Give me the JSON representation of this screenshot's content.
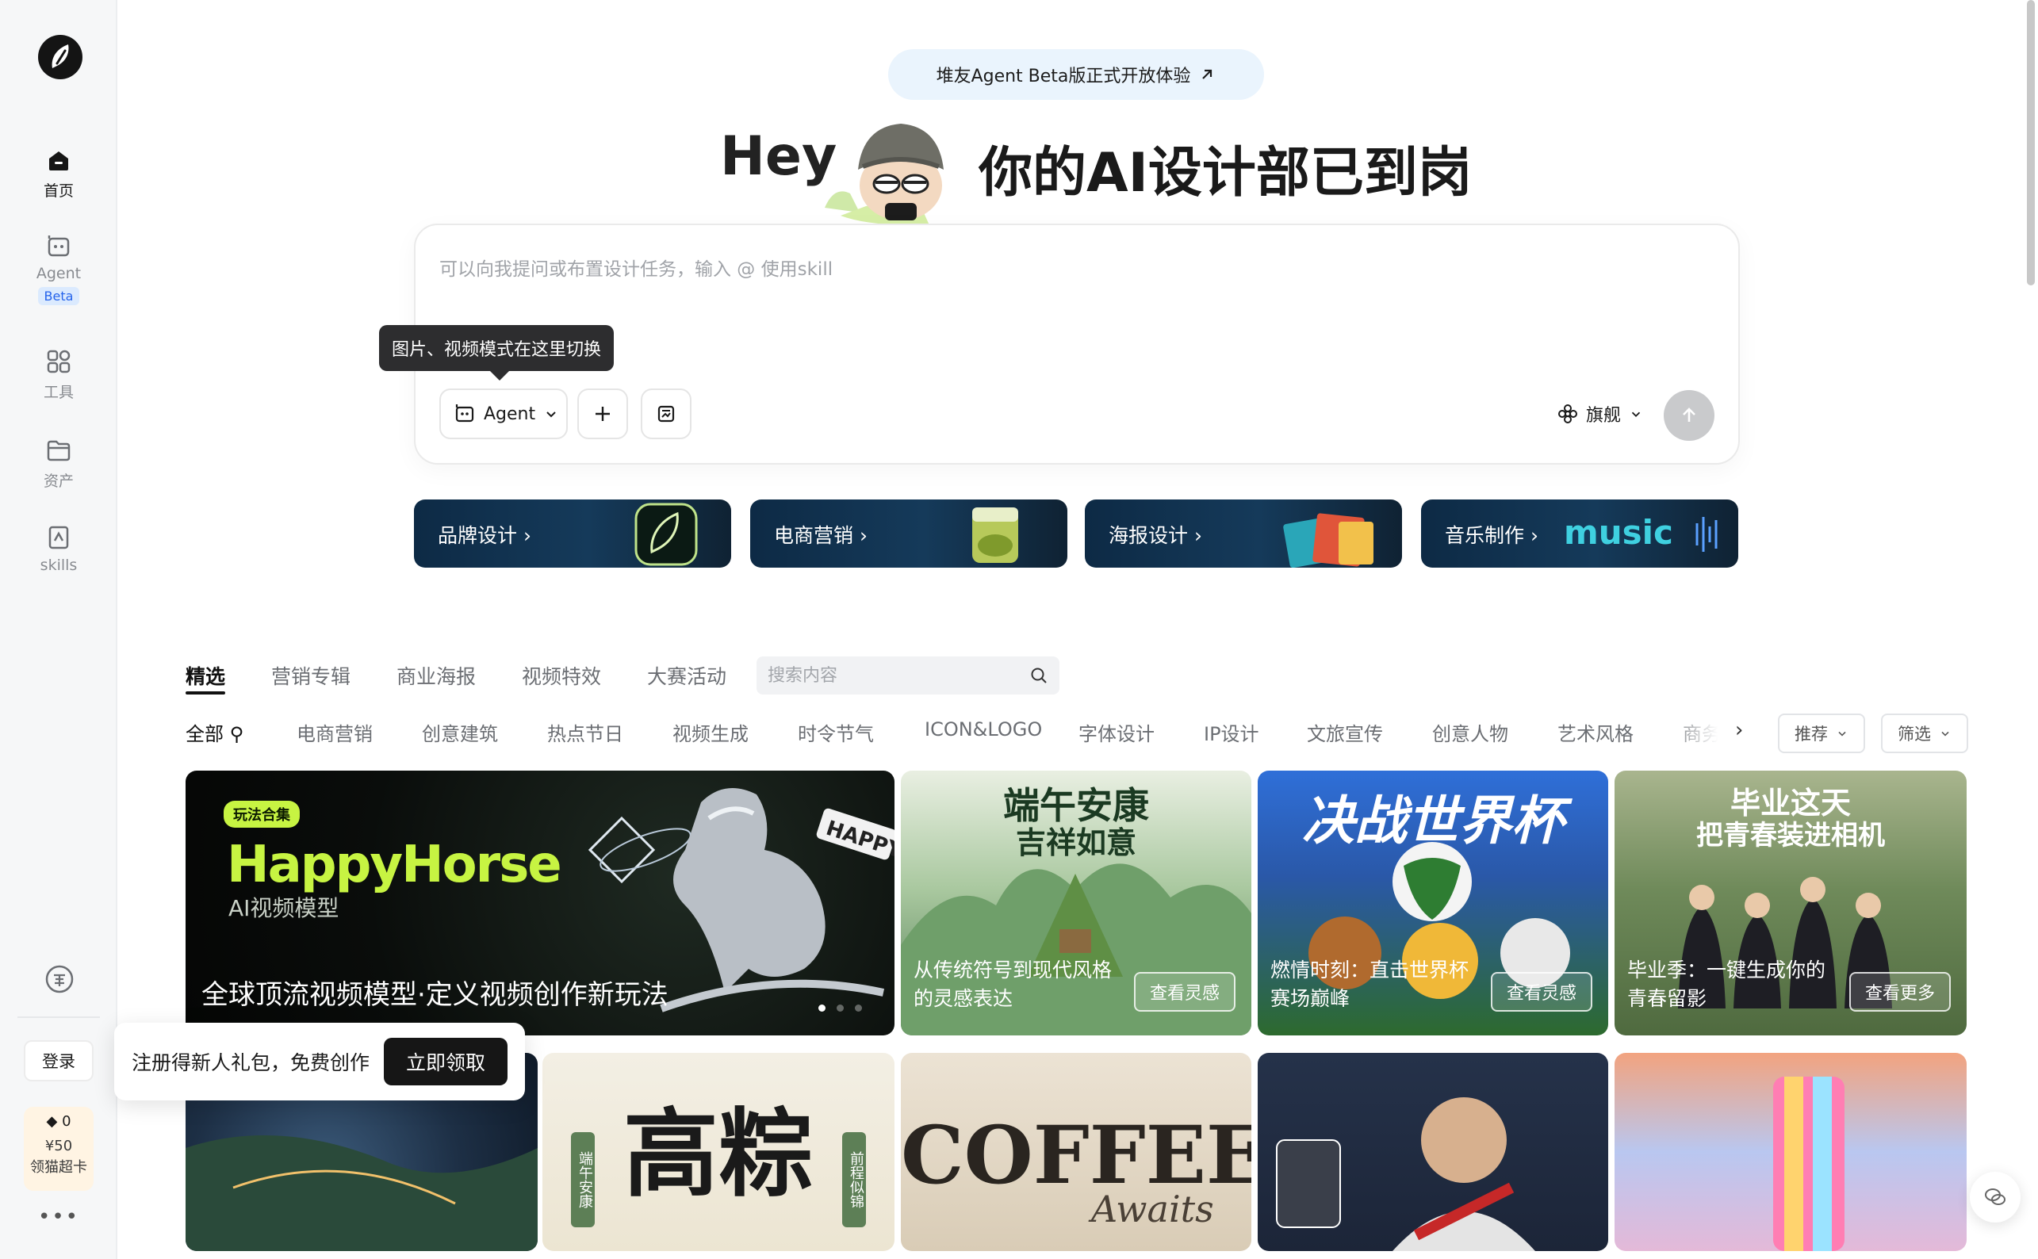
{
  "sidebar": {
    "items": [
      {
        "label": "首页",
        "icon": "home-icon"
      },
      {
        "label": "Agent",
        "icon": "agent-icon",
        "badge": "Beta"
      },
      {
        "label": "工具",
        "icon": "tools-grid-icon"
      },
      {
        "label": "资产",
        "icon": "folder-icon"
      },
      {
        "label": "skills",
        "icon": "skills-icon"
      }
    ],
    "login_label": "登录",
    "credits": {
      "count": "0",
      "price": "¥50",
      "label": "领猫超卡"
    },
    "more": "•••"
  },
  "banner": {
    "text": "堆友Agent Beta版正式开放体验",
    "icon": "arrow-up-right-icon"
  },
  "hero": {
    "hey": "Hey",
    "title": "你的AI设计部已到岗"
  },
  "prompt": {
    "placeholder": "可以向我提问或布置设计任务，输入 @ 使用skill",
    "tooltip": "图片、视频模式在这里切换",
    "mode_label": "Agent",
    "model_label": "旗舰"
  },
  "categories": [
    {
      "label": "品牌设计",
      "deco": "brand-logo"
    },
    {
      "label": "电商营销",
      "deco": "product-jar"
    },
    {
      "label": "海报设计",
      "deco": "poster-stack"
    },
    {
      "label": "音乐制作",
      "deco": "music-wordmark"
    }
  ],
  "category_deco_text": "music",
  "tabs": [
    "精选",
    "营销专辑",
    "商业海报",
    "视频特效",
    "大赛活动"
  ],
  "search": {
    "placeholder": "搜索内容"
  },
  "filters": [
    "全部",
    "电商营销",
    "创意建筑",
    "热点节日",
    "视频生成",
    "时令节气",
    "ICON&LOGO",
    "字体设计",
    "IP设计",
    "文旅宣传",
    "创意人物",
    "艺术风格",
    "商务"
  ],
  "dropdowns": {
    "sort": "推荐",
    "filter": "筛选"
  },
  "featured": {
    "badge": "玩法合集",
    "brand": "HappyHorse",
    "subtitle": "AI视频模型",
    "caption": "全球顶流视频模型·定义视频创作新玩法",
    "sticker": "HAPPY"
  },
  "cards": [
    {
      "headline": "端午安康",
      "headline2": "吉祥如意",
      "caption": [
        "从传统符号到现代风格",
        "的灵感表达"
      ],
      "button": "查看灵感"
    },
    {
      "headline": "决战世界杯",
      "caption": [
        "燃情时刻：直击世界杯",
        "赛场巅峰"
      ],
      "button": "查看灵感"
    },
    {
      "headline": "毕业这天",
      "headline2": "把青春装进相机",
      "caption": [
        "毕业季：一键生成你的",
        "青春留影"
      ],
      "button": "查看更多"
    }
  ],
  "bottom_tiles": {
    "zongzi_title": "高粽",
    "zongzi_left": "端午安康",
    "zongzi_right": "前程似锦",
    "coffee_title": "COFFEE",
    "coffee_script": "Awaits"
  },
  "popup": {
    "text": "注册得新人礼包，免费创作",
    "button": "立即领取"
  },
  "colors": {
    "accent_lime": "#c7f442",
    "dark": "#161616",
    "banner_bg": "#eaf4fd",
    "beta_blue": "#2563eb"
  }
}
